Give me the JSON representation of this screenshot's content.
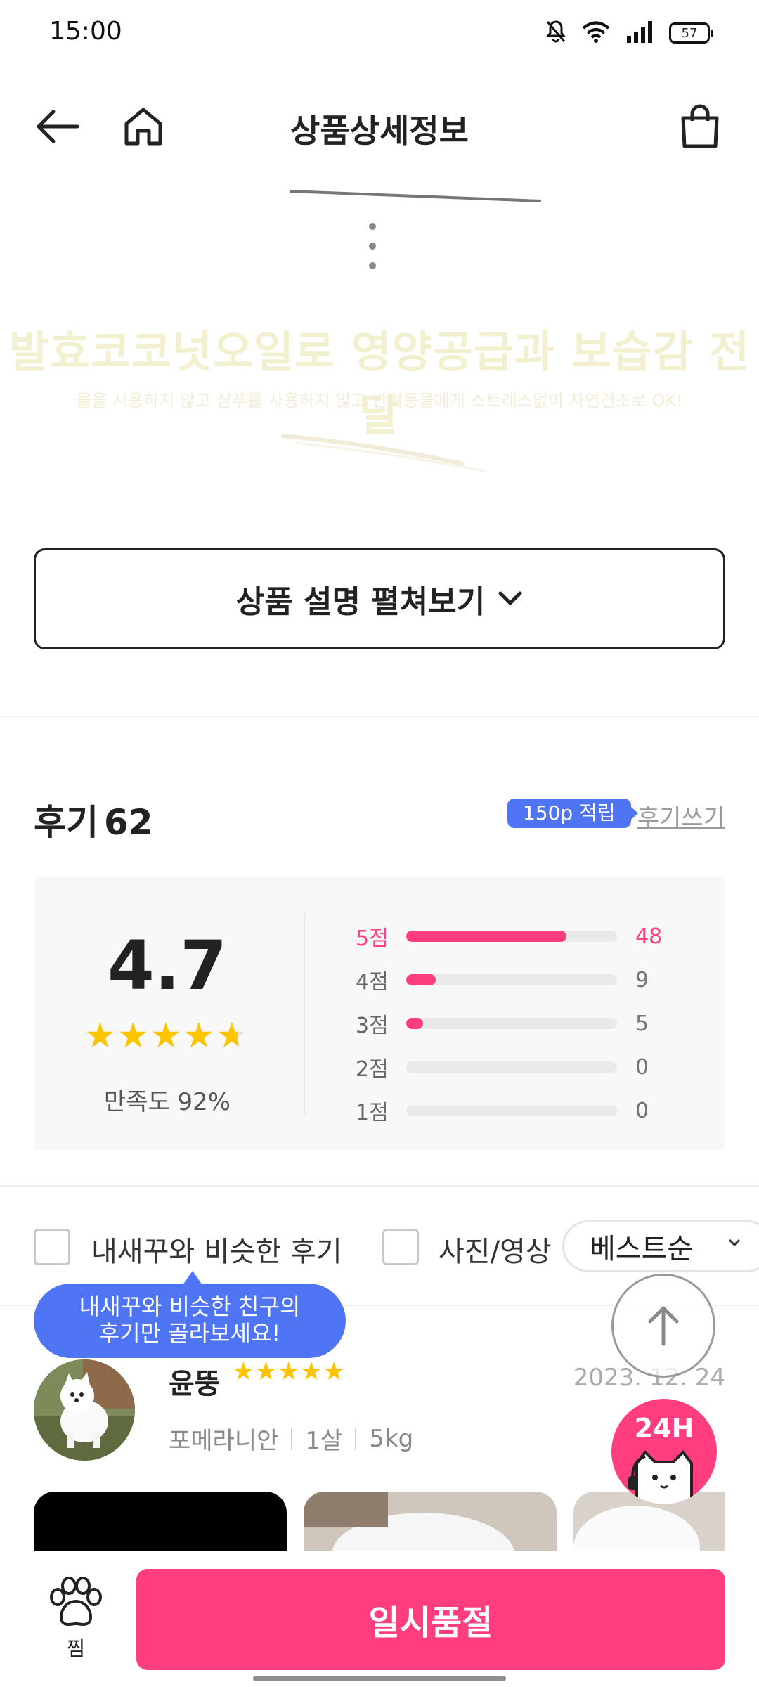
{
  "status_bar": {
    "time": "15:00",
    "battery": "57"
  },
  "header": {
    "title": "상품상세정보"
  },
  "product_visual": {
    "headline": "발효코코넛오일로 영양공급과 보습감 전달",
    "subline": "물을 사용하지 않고 샴푸를 사용하지 않고 반려동물에게 스트레스없이 자연건조로 OK!"
  },
  "expand_button": {
    "label": "상품 설명 펼쳐보기"
  },
  "reviews": {
    "title": "후기",
    "count": "62",
    "points_badge": "150p 적립",
    "write_label": "후기쓰기"
  },
  "rating_summary": {
    "average": "4.7",
    "average_value": 4.7,
    "satisfaction": "만족도 92%",
    "distribution": [
      {
        "label": "5점",
        "count": "48",
        "ratio": 0.76
      },
      {
        "label": "4점",
        "count": "9",
        "ratio": 0.14
      },
      {
        "label": "3점",
        "count": "5",
        "ratio": 0.08
      },
      {
        "label": "2점",
        "count": "0",
        "ratio": 0
      },
      {
        "label": "1점",
        "count": "0",
        "ratio": 0
      }
    ]
  },
  "filters": {
    "similar_label": "내새꾸와 비슷한 후기",
    "photo_label": "사진/영상",
    "sort_selected": "베스트순"
  },
  "tooltip": {
    "line1": "내새꾸와 비슷한 친구의",
    "line2": "후기만 골라보세요!"
  },
  "review_item": {
    "name": "윤뚱",
    "rating": 5,
    "date": "2023. 12. 24",
    "breed": "포메라니안",
    "age": "1살",
    "weight": "5kg"
  },
  "chat_fab": {
    "label": "24H"
  },
  "bottom_bar": {
    "wish_label": "찜",
    "buy_label": "일시품절"
  },
  "colors": {
    "accent_pink": "#ff3d7f",
    "accent_blue": "#4f74f4",
    "star_yellow": "#ffc400"
  }
}
